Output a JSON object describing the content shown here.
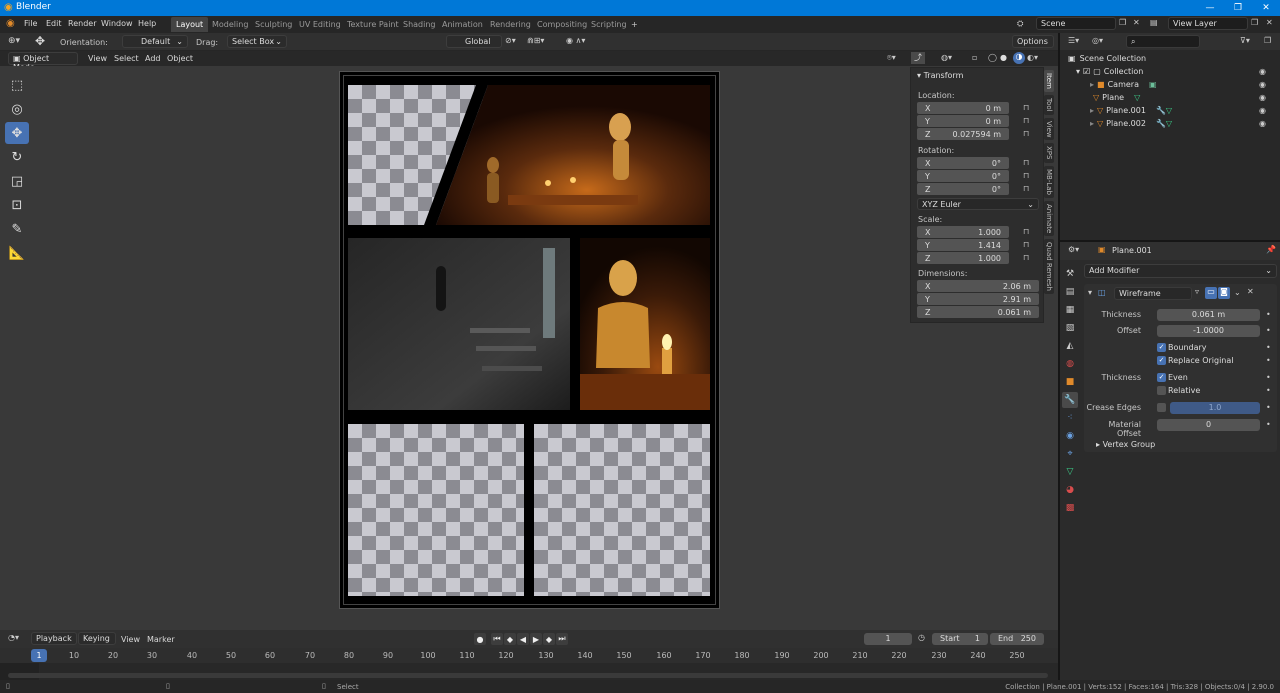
{
  "app": {
    "title": "Blender"
  },
  "menu": [
    "File",
    "Edit",
    "Render",
    "Window",
    "Help"
  ],
  "workspaces": [
    "Layout",
    "Modeling",
    "Sculpting",
    "UV Editing",
    "Texture Paint",
    "Shading",
    "Animation",
    "Rendering",
    "Compositing",
    "Scripting",
    "+"
  ],
  "scene": {
    "scene_name": "Scene",
    "view_layer": "View Layer"
  },
  "toolsettings": {
    "orientation_label": "Orientation:",
    "orientation_value": "Default",
    "drag_label": "Drag:",
    "drag_value": "Select Box",
    "transform_orientation": "Global",
    "options": "Options"
  },
  "viewport_header": {
    "mode": "Object Mode",
    "menus": [
      "View",
      "Select",
      "Add",
      "Object"
    ]
  },
  "npanel": {
    "title": "Transform",
    "location_label": "Location:",
    "location": [
      [
        "X",
        "0 m"
      ],
      [
        "Y",
        "0 m"
      ],
      [
        "Z",
        "0.027594 m"
      ]
    ],
    "rotation_label": "Rotation:",
    "rotation": [
      [
        "X",
        "0°"
      ],
      [
        "Y",
        "0°"
      ],
      [
        "Z",
        "0°"
      ]
    ],
    "rotation_mode": "XYZ Euler",
    "scale_label": "Scale:",
    "scale": [
      [
        "X",
        "1.000"
      ],
      [
        "Y",
        "1.414"
      ],
      [
        "Z",
        "1.000"
      ]
    ],
    "dimensions_label": "Dimensions:",
    "dimensions": [
      [
        "X",
        "2.06 m"
      ],
      [
        "Y",
        "2.91 m"
      ],
      [
        "Z",
        "0.061 m"
      ]
    ],
    "tabs": [
      "Item",
      "Tool",
      "View",
      "XPS",
      "MB-Lab",
      "Animate",
      "Quad Remesh"
    ]
  },
  "outliner": {
    "root": "Scene Collection",
    "collection": "Collection",
    "items": [
      "Camera",
      "Plane",
      "Plane.001",
      "Plane.002"
    ]
  },
  "properties": {
    "object_name": "Plane.001",
    "add_modifier": "Add Modifier",
    "modifier_name": "Wireframe",
    "thickness_label": "Thickness",
    "thickness_value": "0.061 m",
    "offset_label": "Offset",
    "offset_value": "-1.0000",
    "boundary_label": "Boundary",
    "replace_original_label": "Replace Original",
    "thickness2_label": "Thickness",
    "even_label": "Even",
    "relative_label": "Relative",
    "crease_edges_label": "Crease Edges",
    "crease_value": "1.0",
    "material_offset_label": "Material Offset",
    "material_offset_value": "0",
    "vertex_group_label": "Vertex Group"
  },
  "timeline": {
    "menus": [
      "Playback",
      "Keying",
      "View",
      "Marker"
    ],
    "current_frame": "1",
    "start_label": "Start",
    "start_value": "1",
    "end_label": "End",
    "end_value": "250",
    "ruler": [
      "1",
      "10",
      "20",
      "30",
      "40",
      "50",
      "60",
      "70",
      "80",
      "90",
      "100",
      "110",
      "120",
      "130",
      "140",
      "150",
      "160",
      "170",
      "180",
      "190",
      "200",
      "210",
      "220",
      "230",
      "240",
      "250"
    ]
  },
  "status": {
    "select_label": "Select",
    "stats": "Collection | Plane.001 | Verts:152 | Faces:164 | Tris:328 | Objects:0/4 | 2.90.0"
  },
  "colors": {
    "accent": "#4772b3",
    "titlebar": "#0078d7"
  }
}
